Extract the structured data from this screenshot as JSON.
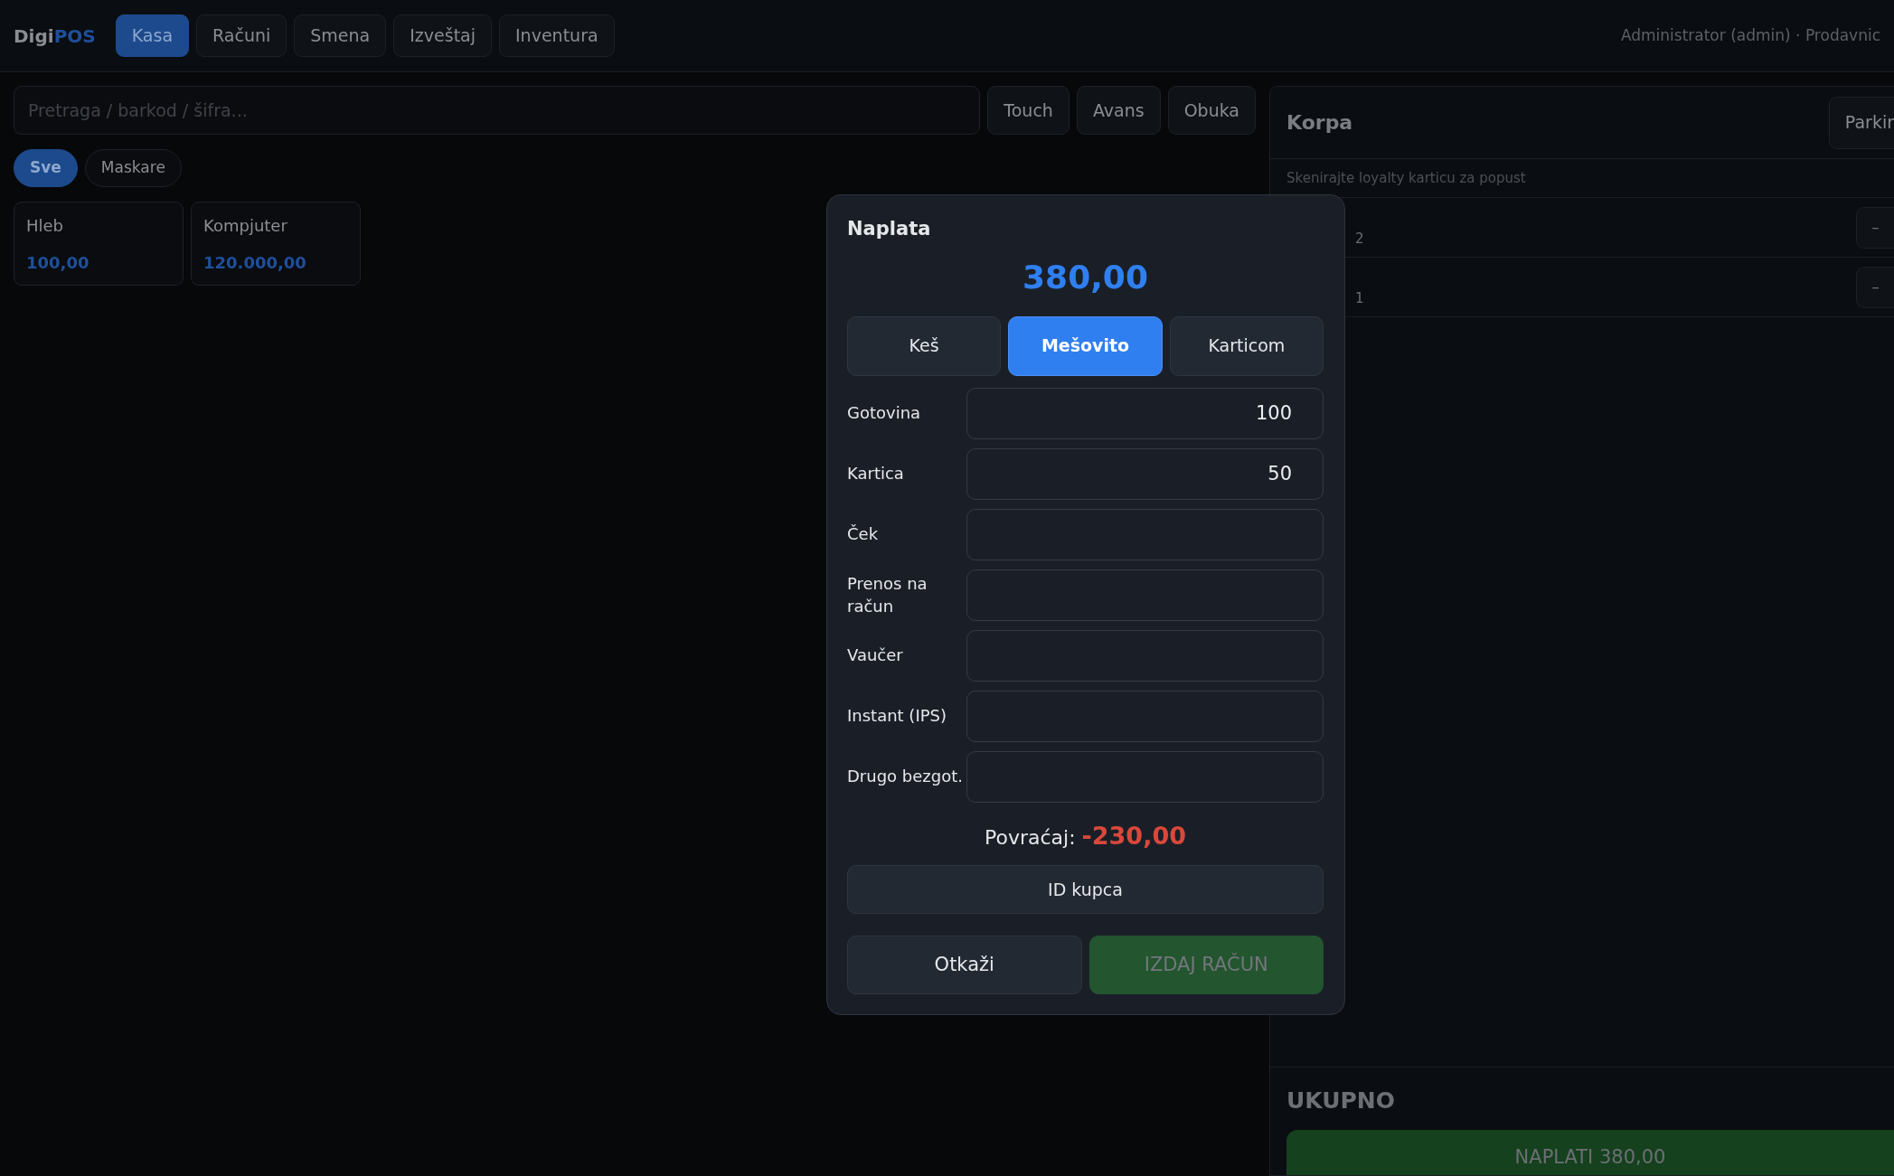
{
  "header": {
    "logo": [
      "Digi",
      "POS"
    ],
    "nav": [
      {
        "label": "Kasa",
        "selected": true
      },
      {
        "label": "Računi",
        "selected": false
      },
      {
        "label": "Smena",
        "selected": false
      },
      {
        "label": "Izveštaj",
        "selected": false
      },
      {
        "label": "Inventura",
        "selected": false
      }
    ],
    "user": "Administrator (admin) · Prodavnic"
  },
  "search": {
    "placeholder": "Pretraga / barkod / šifra..."
  },
  "tool_buttons": [
    "Touch",
    "Avans",
    "Obuka"
  ],
  "categories": [
    {
      "label": "Sve",
      "selected": true
    },
    {
      "label": "Maskare",
      "selected": false
    }
  ],
  "products": [
    {
      "name": "Hleb",
      "price": "100,00"
    },
    {
      "name": "Kompjuter",
      "price": "120.000,00"
    }
  ],
  "cart": {
    "title": "Korpa",
    "park_button": "Parkir",
    "loyalty_hint": "Skenirajte loyalty karticu za popust",
    "rows": [
      {
        "quantity": "2",
        "minus": "–"
      },
      {
        "quantity": "1",
        "minus": "–"
      }
    ],
    "total_label": "UKUPNO",
    "pay_button": "NAPLATI 380,00"
  },
  "payment_dialog": {
    "title": "Naplata",
    "amount": "380,00",
    "methods": [
      {
        "label": "Keš",
        "selected": false
      },
      {
        "label": "Mešovito",
        "selected": true
      },
      {
        "label": "Karticom",
        "selected": false
      }
    ],
    "fields": [
      {
        "label": "Gotovina",
        "value": "100"
      },
      {
        "label": "Kartica",
        "value": "50"
      },
      {
        "label": "Ček"
      },
      {
        "label": "Prenos na račun"
      },
      {
        "label": "Vaučer"
      },
      {
        "label": "Instant (IPS)"
      },
      {
        "label": "Drugo bezgot."
      }
    ],
    "change_label": "Povraćaj:",
    "change_value": "-230,00",
    "customer_id_button": "ID kupca",
    "cancel_button": "Otkaži",
    "issue_button": {
      "label": "IZDAJ RAČUN",
      "disabled": true
    }
  }
}
